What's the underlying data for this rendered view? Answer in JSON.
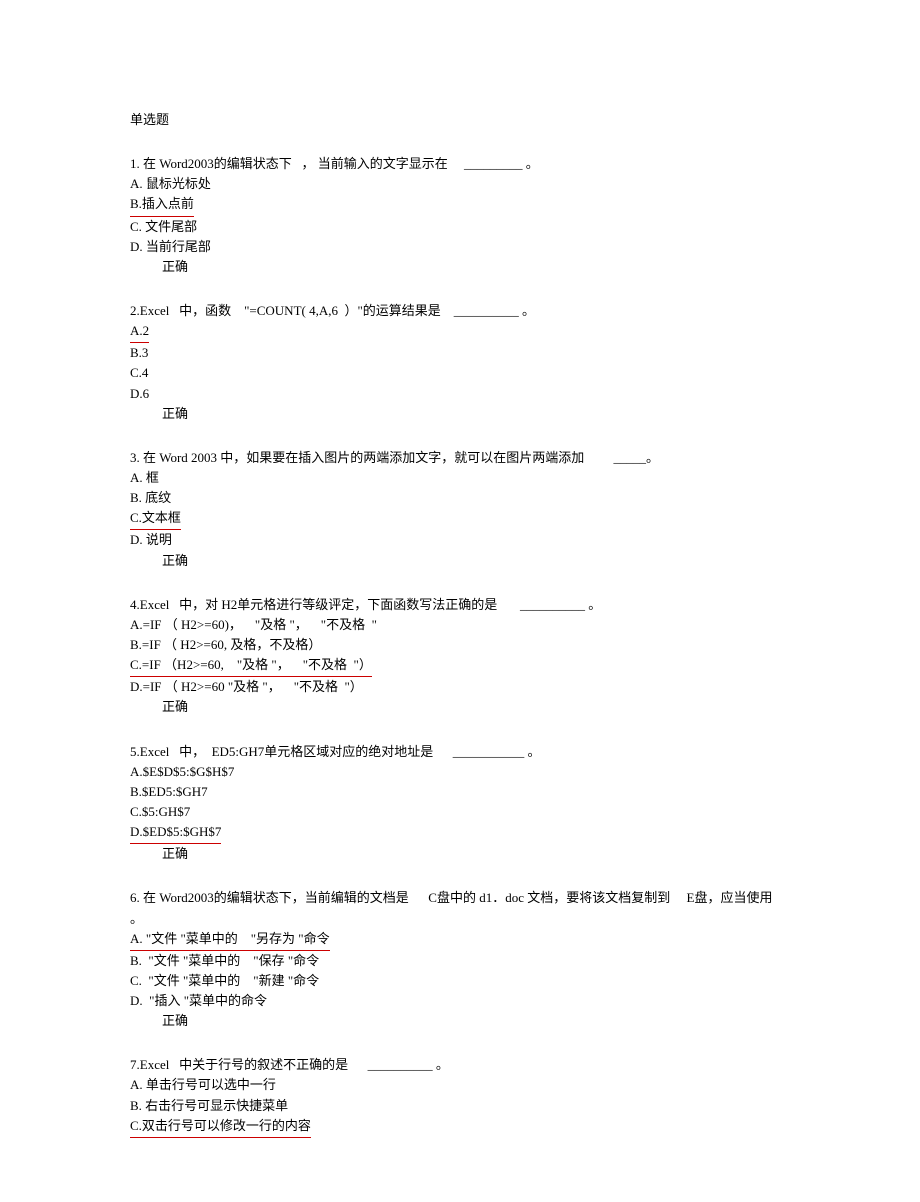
{
  "header": "单选题",
  "questions": [
    {
      "q": "1. 在 Word2003的编辑状态下   ， 当前输入的文字显示在     _________ 。",
      "opts": [
        {
          "t": "A. 鼠标光标处",
          "u": false
        },
        {
          "t": "B.插入点前",
          "u": true
        },
        {
          "t": "C. 文件尾部",
          "u": false
        },
        {
          "t": "D. 当前行尾部",
          "u": false
        }
      ],
      "c": "正确"
    },
    {
      "q": "2.Excel   中，函数    \"=COUNT( 4,A,6  ）\"的运算结果是    __________ 。",
      "opts": [
        {
          "t": "A.2",
          "u": true
        },
        {
          "t": "B.3",
          "u": false
        },
        {
          "t": "C.4",
          "u": false
        },
        {
          "t": "D.6",
          "u": false
        }
      ],
      "c": "正确"
    },
    {
      "q": "3. 在 Word 2003 中，如果要在插入图片的两端添加文字，就可以在图片两端添加         _____。",
      "opts": [
        {
          "t": "A. 框",
          "u": false
        },
        {
          "t": "B. 底纹",
          "u": false
        },
        {
          "t": "C.文本框",
          "u": true
        },
        {
          "t": "D. 说明",
          "u": false
        }
      ],
      "c": "正确"
    },
    {
      "q": "4.Excel   中，对 H2单元格进行等级评定，下面函数写法正确的是       __________ 。",
      "opts": [
        {
          "t": "A.=IF （ H2>=60)，    \"及格 \"，    \"不及格  \"",
          "u": false
        },
        {
          "t": "B.=IF （ H2>=60, 及格，不及格）",
          "u": false
        },
        {
          "t": "C.=IF （H2>=60,    \"及格 \"，    \"不及格  \"）",
          "u": true
        },
        {
          "t": "D.=IF （ H2>=60 \"及格 \"，    \"不及格  \"）",
          "u": false
        }
      ],
      "c": "正确"
    },
    {
      "q": "5.Excel   中，  ED5:GH7单元格区域对应的绝对地址是      ___________ 。",
      "opts": [
        {
          "t": "A.$E$D$5:$G$H$7",
          "u": false
        },
        {
          "t": "B.$ED5:$GH7",
          "u": false
        },
        {
          "t": "C.$5:GH$7",
          "u": false
        },
        {
          "t": "D.$ED$5:$GH$7",
          "u": true
        }
      ],
      "c": "正确"
    },
    {
      "q": "6. 在 Word2003的编辑状态下，当前编辑的文档是      C盘中的 d1．doc 文档，要将该文档复制到     E盘，应当使用  。",
      "opts": [
        {
          "t": "A. \"文件 \"菜单中的    \"另存为 \"命令",
          "u": true
        },
        {
          "t": "B.  \"文件 \"菜单中的    \"保存 \"命令",
          "u": false
        },
        {
          "t": "C.  \"文件 \"菜单中的    \"新建 \"命令",
          "u": false
        },
        {
          "t": "D.  \"插入 \"菜单中的命令",
          "u": false
        }
      ],
      "c": "正确"
    },
    {
      "q": "7.Excel   中关于行号的叙述不正确的是      __________ 。",
      "opts": [
        {
          "t": "A. 单击行号可以选中一行",
          "u": false
        },
        {
          "t": "B. 右击行号可显示快捷菜单",
          "u": false
        },
        {
          "t": "C.双击行号可以修改一行的内容",
          "u": true
        }
      ],
      "c": ""
    }
  ]
}
